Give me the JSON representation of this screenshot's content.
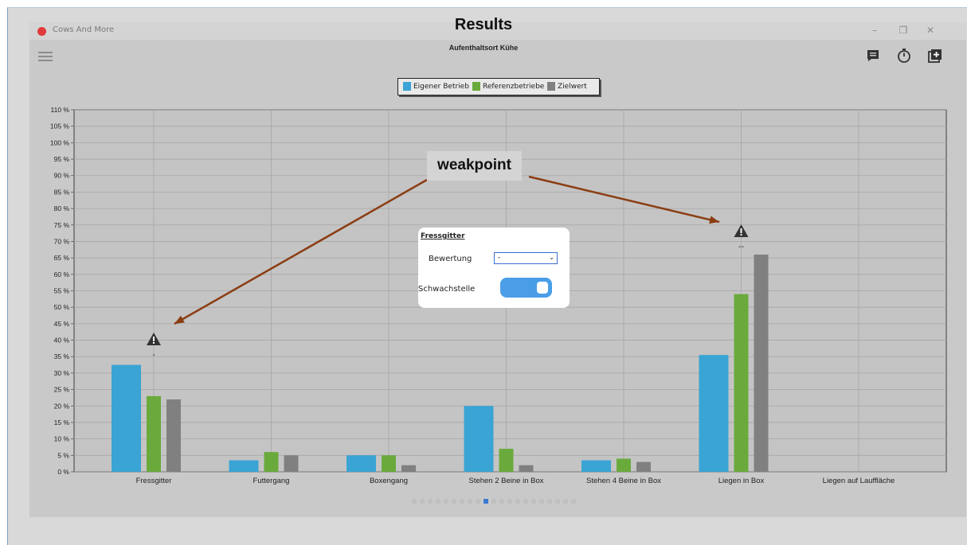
{
  "overlay": {
    "results_title": "Results",
    "weakpoint_label": "weakpoint"
  },
  "window": {
    "app_title": "Cows And More",
    "controls": {
      "minimize": "–",
      "restore": "❐",
      "close": "✕"
    }
  },
  "toolbar": {
    "icons": [
      "menu-icon",
      "comment-icon",
      "stopwatch-icon",
      "add-chart-icon"
    ]
  },
  "chart_data": {
    "type": "bar",
    "title": "Aufenthaltsort Kühe",
    "categories": [
      "Fressgitter",
      "Futtergang",
      "Boxengang",
      "Stehen 2 Beine in Box",
      "Stehen 4 Beine in Box",
      "Liegen in Box",
      "Liegen auf Lauffläche"
    ],
    "series": [
      {
        "name": "Eigener Betrieb",
        "color": "#3aa4d4",
        "values": [
          32.5,
          3.5,
          5,
          20,
          3.5,
          35.5,
          0
        ]
      },
      {
        "name": "Referenzbetriebe",
        "color": "#6aaa3c",
        "values": [
          23,
          6,
          5,
          7,
          4,
          54,
          0
        ]
      },
      {
        "name": "Zielwert",
        "color": "#808080",
        "values": [
          22,
          5,
          2,
          2,
          3,
          66,
          0
        ]
      }
    ],
    "ylim": [
      0,
      110
    ],
    "yticks": [
      "0 %",
      "5 %",
      "10 %",
      "15 %",
      "20 %",
      "25 %",
      "30 %",
      "35 %",
      "40 %",
      "45 %",
      "50 %",
      "55 %",
      "60 %",
      "65 %",
      "70 %",
      "75 %",
      "80 %",
      "85 %",
      "90 %",
      "95 %",
      "100 %",
      "105 %",
      "110 %"
    ],
    "grid": true,
    "legend_position": "top-center",
    "warnings": [
      {
        "category": "Fressgitter",
        "icon": "warning-icon",
        "mark": "-"
      },
      {
        "category": "Liegen in Box",
        "icon": "warning-icon",
        "mark": "--"
      }
    ]
  },
  "popup": {
    "title": "Fressgitter",
    "rating_label": "Bewertung",
    "rating_value": "-",
    "weakpoint_label": "Schwachstelle",
    "weakpoint_on": true
  },
  "pager": {
    "total": 21,
    "active": 10
  }
}
